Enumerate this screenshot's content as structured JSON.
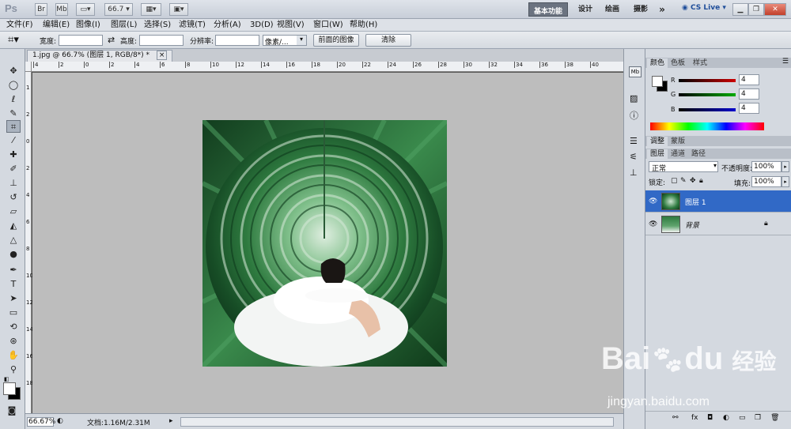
{
  "titlebar": {
    "app_logo": "Ps",
    "br_label": "Br",
    "mb_label": "Mb",
    "zoom_value": "66.7",
    "workspaces": [
      "基本功能",
      "设计",
      "绘画",
      "摄影"
    ],
    "more_label": "»",
    "cs_live_label": "CS Live"
  },
  "menu": [
    "文件(F)",
    "编辑(E)",
    "图像(I)",
    "图层(L)",
    "选择(S)",
    "滤镜(T)",
    "分析(A)",
    "3D(D)",
    "视图(V)",
    "窗口(W)",
    "帮助(H)"
  ],
  "options": {
    "width_label": "宽度:",
    "height_label": "高度:",
    "resolution_label": "分辨率:",
    "unit_value": "像素/...",
    "front_image_button": "前面的图像",
    "clear_button": "清除"
  },
  "document": {
    "tab_title": "1.jpg @ 66.7% (图层 1, RGB/8*) *",
    "close_glyph": "×",
    "ruler_top_marks": [
      "4",
      "2",
      "0",
      "2",
      "4",
      "6",
      "8",
      "10",
      "12",
      "14",
      "16",
      "18",
      "20",
      "22",
      "24",
      "26",
      "28",
      "30",
      "32",
      "34",
      "36",
      "38",
      "40"
    ],
    "ruler_left_marks": [
      "1",
      "2",
      "0",
      "2",
      "4",
      "6",
      "8",
      "10",
      "12",
      "14",
      "16",
      "18"
    ]
  },
  "status": {
    "zoom": "66.67%",
    "doc_size": "文档:1.16M/2.31M"
  },
  "color_panel": {
    "tabs": [
      "颜色",
      "色板",
      "样式"
    ],
    "channels": [
      {
        "label": "R",
        "value": "4",
        "color": "#cc0000"
      },
      {
        "label": "G",
        "value": "4",
        "color": "#00aa00"
      },
      {
        "label": "B",
        "value": "4",
        "color": "#0000cc"
      }
    ]
  },
  "adjust_panel": {
    "tabs": [
      "调整",
      "蒙版"
    ]
  },
  "layers_panel": {
    "tabs": [
      "图层",
      "通道",
      "路径"
    ],
    "blend_mode": "正常",
    "opacity_label": "不透明度:",
    "opacity_value": "100%",
    "lock_label": "锁定:",
    "fill_label": "填充:",
    "fill_value": "100%",
    "layers": [
      {
        "name": "图层 1",
        "selected": true
      },
      {
        "name": "背景",
        "selected": false
      }
    ]
  },
  "watermark": {
    "brand": "Bai",
    "brand2": "du",
    "cn": "经验",
    "url": "jingyan.baidu.com"
  },
  "colors": {
    "selected_layer": "#3169c6",
    "canvas_bg": "#bdbdbd",
    "image_green": "#2e7a3f"
  }
}
